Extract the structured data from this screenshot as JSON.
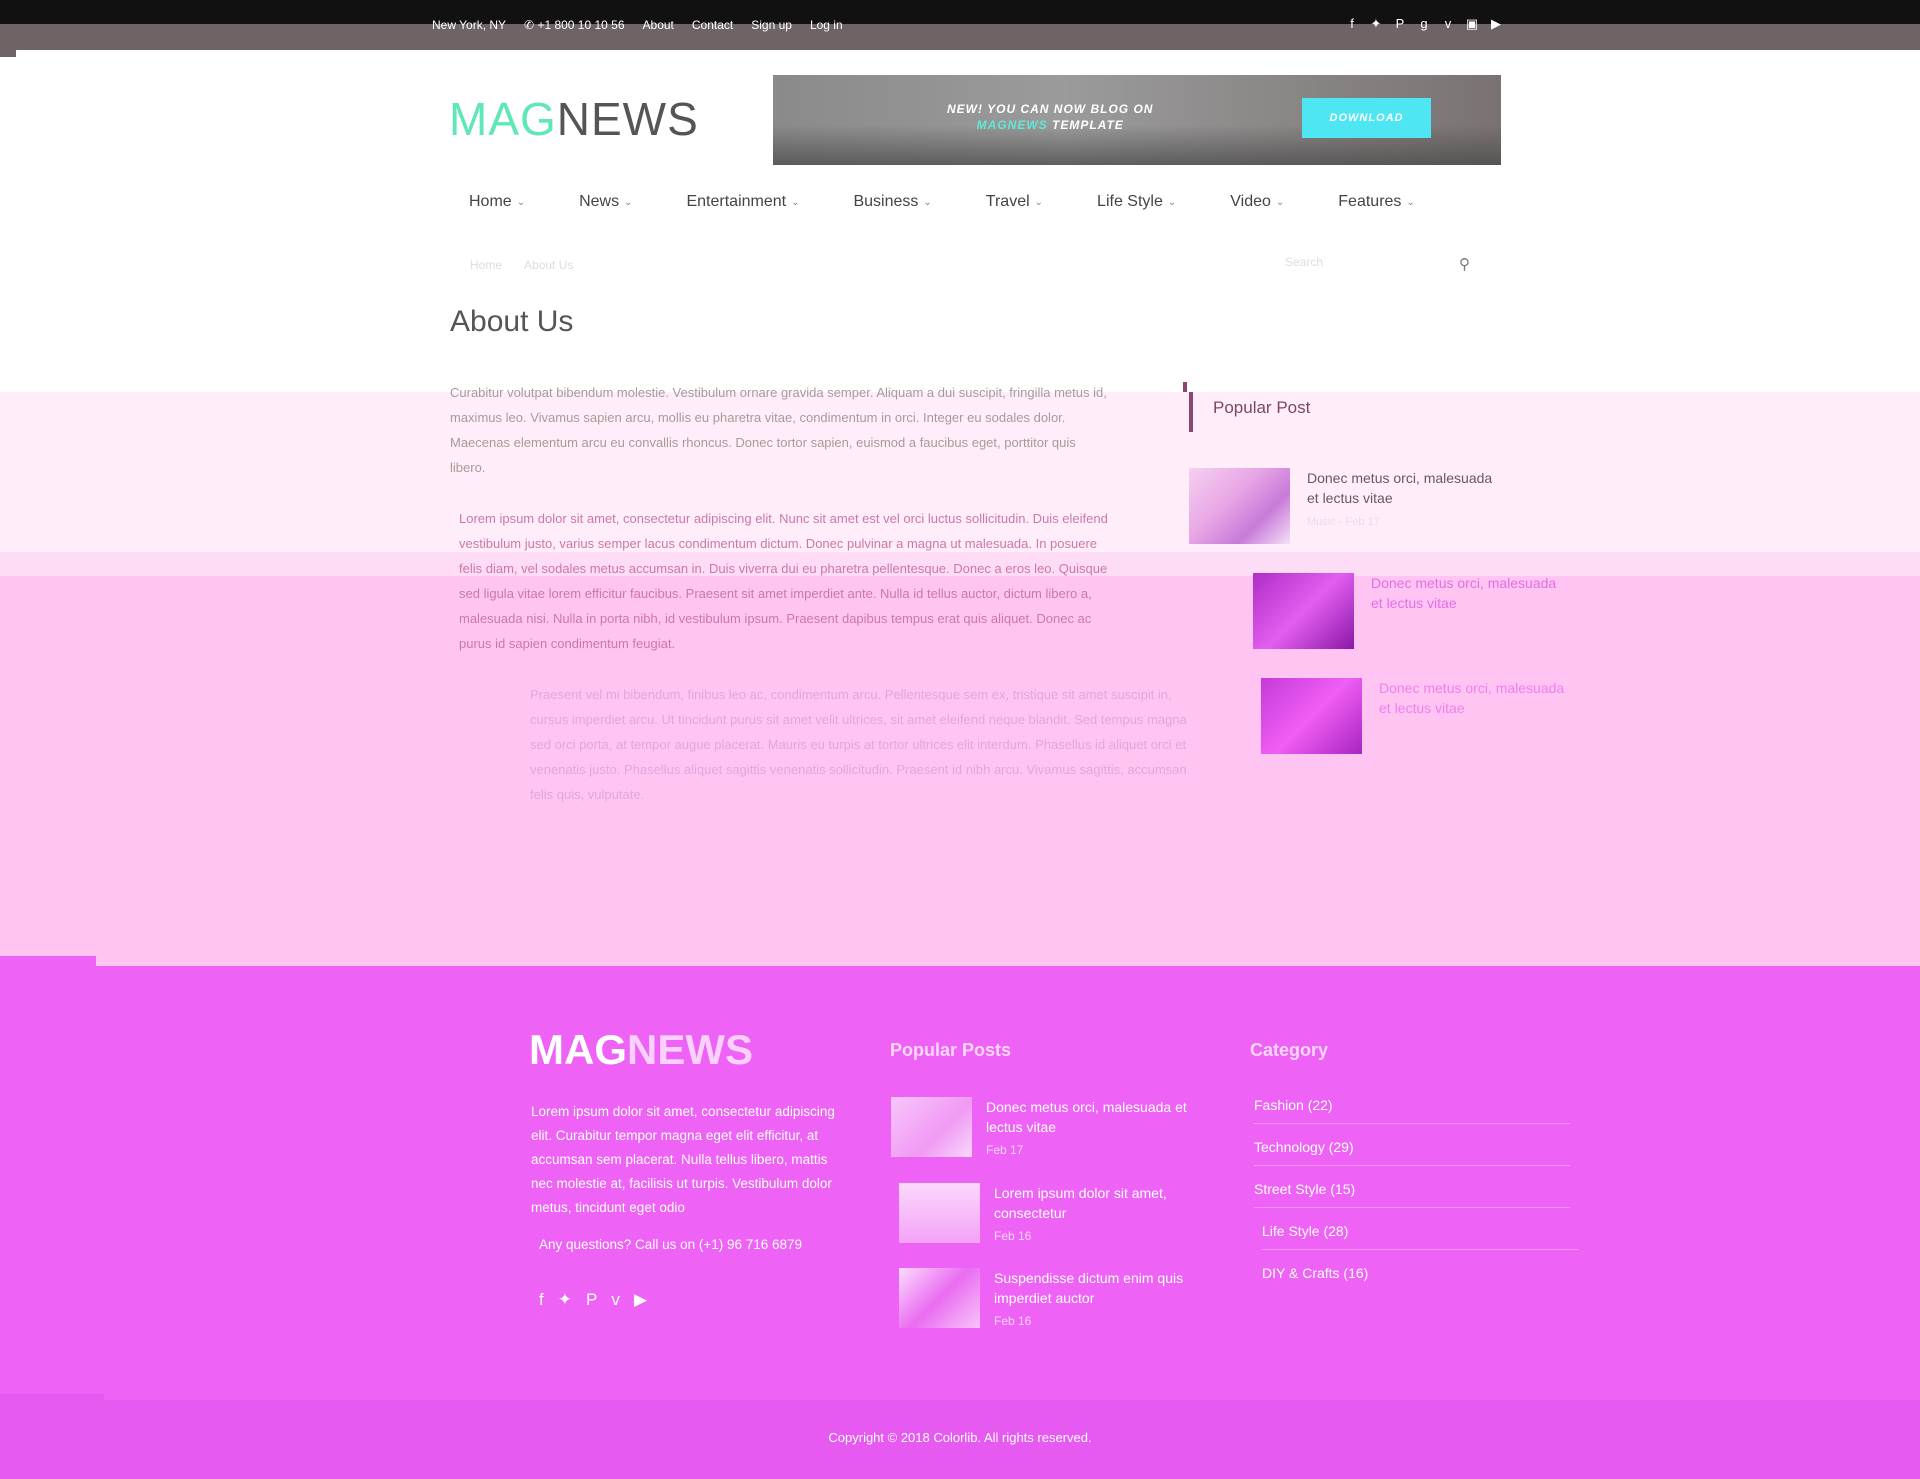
{
  "topbar": {
    "location": "New York, NY",
    "phone": "+1 800 10 10 56",
    "links": [
      "About",
      "Contact",
      "Sign up",
      "Log in"
    ],
    "social_icons": [
      "facebook-icon",
      "twitter-icon",
      "pinterest-icon",
      "google-plus-icon",
      "vimeo-icon",
      "instagram-icon",
      "youtube-icon"
    ]
  },
  "header": {
    "logo_part1": "MAG",
    "logo_part2": "NEWS",
    "banner_line1_bold": "NEW!",
    "banner_line1_rest": " YOU CAN NOW BLOG ON",
    "banner_line2_highlight": "MAGNEWS",
    "banner_line2_rest": " TEMPLATE",
    "banner_button": "DOWNLOAD"
  },
  "nav": {
    "items": [
      "Home",
      "News",
      "Entertainment",
      "Business",
      "Travel",
      "Life Style",
      "Video",
      "Features"
    ]
  },
  "breadcrumb": {
    "items": [
      "Home",
      "About Us"
    ]
  },
  "search": {
    "placeholder": "Search"
  },
  "page": {
    "title": "About Us",
    "paragraphs": [
      "Curabitur volutpat bibendum molestie. Vestibulum ornare gravida semper. Aliquam a dui suscipit, fringilla metus id, maximus leo. Vivamus sapien arcu, mollis eu pharetra vitae, condimentum in orci. Integer eu sodales dolor. Maecenas elementum arcu eu convallis rhoncus. Donec tortor sapien, euismod a faucibus eget, porttitor quis libero.",
      "Lorem ipsum dolor sit amet, consectetur adipiscing elit. Nunc sit amet est vel orci luctus sollicitudin. Duis eleifend vestibulum justo, varius semper lacus condimentum dictum. Donec pulvinar a magna ut malesuada. In posuere felis diam, vel sodales metus accumsan in. Duis viverra dui eu pharetra pellentesque. Donec a eros leo. Quisque sed ligula vitae lorem efficitur faucibus. Praesent sit amet imperdiet ante. Nulla id tellus auctor, dictum libero a, malesuada nisi. Nulla in porta nibh, id vestibulum ipsum. Praesent dapibus tempus erat quis aliquet. Donec ac purus id sapien condimentum feugiat.",
      "Praesent vel mi bibendum, finibus leo ac, condimentum arcu. Pellentesque sem ex, tristique sit amet suscipit in, cursus imperdiet arcu. Ut tincidunt purus sit amet velit ultrices, sit amet eleifend neque blandit. Sed tempus magna sed orci porta, at tempor augue placerat. Mauris eu turpis at tortor ultrices elit interdum. Phasellus id aliquet orci et venenatis justo. Phasellus aliquet sagittis venenatis sollicitudin. Praesent id nibh arcu. Vivamus sagittis, accumsan felis quis, vulputate."
    ]
  },
  "sidebar": {
    "title": "Popular Post",
    "posts": [
      {
        "title": "Donec metus orci, malesuada et lectus vitae",
        "meta": "Music - Feb 17"
      },
      {
        "title": "Donec metus orci, malesuada et lectus vitae",
        "meta": ""
      },
      {
        "title": "Donec metus orci, malesuada et lectus vitae",
        "meta": ""
      }
    ]
  },
  "footer": {
    "logo_part1": "MAG",
    "logo_part2": "NEWS",
    "about": "Lorem ipsum dolor sit amet, consectetur adipiscing elit. Curabitur tempor magna eget elit efficitur, at accumsan sem placerat. Nulla tellus libero, mattis nec molestie at, facilisis ut turpis. Vestibulum dolor metus, tincidunt eget odio",
    "call": "Any questions? Call us on (+1) 96 716 6879",
    "social_icons": [
      "facebook-icon",
      "twitter-icon",
      "pinterest-icon",
      "vimeo-icon",
      "youtube-icon"
    ],
    "popular_title": "Popular Posts",
    "popular": [
      {
        "title": "Donec metus orci, malesuada et lectus vitae",
        "date": "Feb 17"
      },
      {
        "title": "Lorem ipsum dolor sit amet, consectetur",
        "date": "Feb 16"
      },
      {
        "title": "Suspendisse dictum enim quis imperdiet auctor",
        "date": "Feb 16"
      }
    ],
    "category_title": "Category",
    "categories": [
      "Fashion (22)",
      "Technology (29)",
      "Street Style (15)",
      "Life Style (28)",
      "DIY & Crafts (16)"
    ],
    "copyright": "Copyright © 2018 Colorlib. All rights reserved."
  },
  "colors": {
    "accent": "#5fe8b6",
    "footer_bg": "#ee62f6",
    "button": "#4ee6f2"
  }
}
